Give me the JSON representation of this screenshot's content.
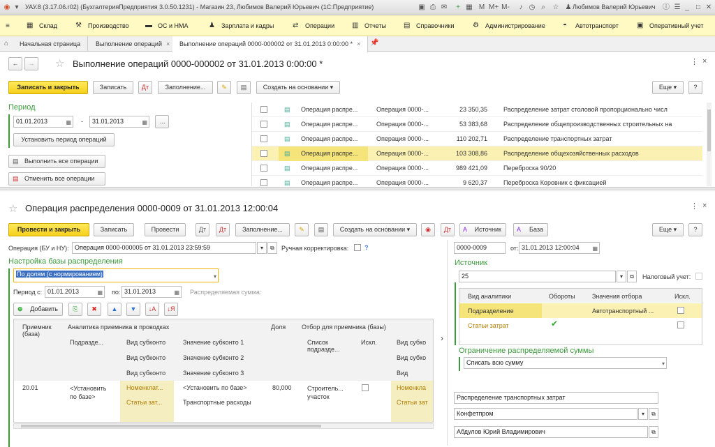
{
  "titlebar": {
    "text": "УАУ.8 (3.17.06.r02) (БухгалтерияПредприятия 3.0.50.1231) - Магазин 23, Любимов Валерий Юрьевич (1С:Предприятие)",
    "user": "Любимов Валерий Юрьевич"
  },
  "menu": [
    "Склад",
    "Производство",
    "ОС и НМА",
    "Зарплата и кадры",
    "Операции",
    "Отчеты",
    "Справочники",
    "Администрирование",
    "Автотранспорт",
    "Оперативный учет"
  ],
  "tabs": [
    {
      "label": "Начальная страница"
    },
    {
      "label": "Выполнение операций"
    },
    {
      "label": "Выполнение операций 0000-000002 от 31.01.2013 0:00:00 *"
    }
  ],
  "doc1": {
    "title": "Выполнение операций 0000-000002 от 31.01.2013 0:00:00 *",
    "save_close": "Записать и закрыть",
    "save": "Записать",
    "fill": "Заполнение...",
    "create_based": "Создать на основании",
    "more": "Еще",
    "help": "?",
    "period_label": "Период",
    "date_from": "01.01.2013",
    "dash": "-",
    "date_to": "31.01.2013",
    "dots": "...",
    "set_period": "Установить период операций",
    "run_all": "Выполнить все операции",
    "cancel_all": "Отменить все операции",
    "rows": [
      {
        "c1": "Операция распре...",
        "c2": "Операция 0000-...",
        "sum": "23 350,35",
        "desc": "Распределение затрат столовой пропорционально числ"
      },
      {
        "c1": "Операция распре...",
        "c2": "Операция 0000-...",
        "sum": "53 383,68",
        "desc": "Распределение общепроизводственных строительных на"
      },
      {
        "c1": "Операция распре...",
        "c2": "Операция 0000-...",
        "sum": "110 202,71",
        "desc": "Распределение транспортных затрат"
      },
      {
        "c1": "Операция распре...",
        "c2": "Операция 0000-...",
        "sum": "103 308,86",
        "desc": "Распределение общехозяйственных расходов"
      },
      {
        "c1": "Операция распре...",
        "c2": "Операция 0000-...",
        "sum": "989 421,09",
        "desc": "Переброска 90/20"
      },
      {
        "c1": "Операция распре...",
        "c2": "Операция 0000-...",
        "sum": "9 620,37",
        "desc": "Переброска Коровник с фиксацией"
      }
    ]
  },
  "doc2": {
    "title": "Операция распределения 0000-0009 от 31.01.2013 12:00:04",
    "post_close": "Провести и закрыть",
    "save": "Записать",
    "post": "Провести",
    "fill": "Заполнение...",
    "create_based": "Создать на основании",
    "source_btn": "Источник",
    "base_btn": "База",
    "more": "Еще",
    "help": "?",
    "op_label": "Операция (БУ и НУ):",
    "op_value": "Операция 0000-000005 от 31.01.2013 23:59:59",
    "manual_label": "Ручная корректировка:",
    "q": "?",
    "number": "0000-0009",
    "from_label": "от:",
    "date": "31.01.2013 12:00:04",
    "base_section": "Настройка базы распределения",
    "base_value": "По долям (с нормированием)",
    "period_from_label": "Период с:",
    "period_from": "01.01.2013",
    "period_to_label": "по:",
    "period_to": "31.01.2013",
    "distrib_sum": "Распределяемая сумма:",
    "add": "Добавить",
    "table": {
      "h_receiver": "Приемник (база)",
      "h_analytics": "Аналитика приемника  в проводках",
      "h_share": "Доля",
      "h_filter": "Отбор для приемника (базы)",
      "h_sub": "Подразде...",
      "h_kind1": "Вид субконто",
      "h_val1": "Значение субконто 1",
      "h_kind2": "Вид субконто",
      "h_val2": "Значение субконто 2",
      "h_kind3": "Вид субконто",
      "h_val3": "Значение субконто 3",
      "h_list": "Список подразде...",
      "h_excl": "Искл.",
      "h_kind_r": "Вид субко",
      "h_kind_r2": "Вид субко",
      "h_kind_r3": "Вид",
      "r_receiver": "20.01",
      "r_sub": "<Установить по базе>",
      "r_kind1": "Номенклат...",
      "r_kind2": "Статьи зат...",
      "r_val1": "<Установить по базе>",
      "r_val2": "Транспортные расходы",
      "r_share": "80,000",
      "r_list": "Строитель... участок",
      "r_kind_r1": "Номенкла",
      "r_kind_r2": "Статьи зат"
    },
    "source_section": "Источник",
    "source_value": "25",
    "tax_label": "Налоговый учет:",
    "src_table": {
      "h_kind": "Вид аналитики",
      "h_turn": "Обороты",
      "h_val": "Значения отбора",
      "h_excl": "Искл.",
      "r1_kind": "Подразделение",
      "r1_val": "Автотранспортный ...",
      "r2_kind": "Статьи затрат"
    },
    "limit_section": "Ограничение распределяемой суммы",
    "limit_value": "Списать всю сумму",
    "desc_value": "Распределение транспортных затрат",
    "org_value": "Конфетпром",
    "resp_value": "Абдулов Юрий Владимирович"
  }
}
